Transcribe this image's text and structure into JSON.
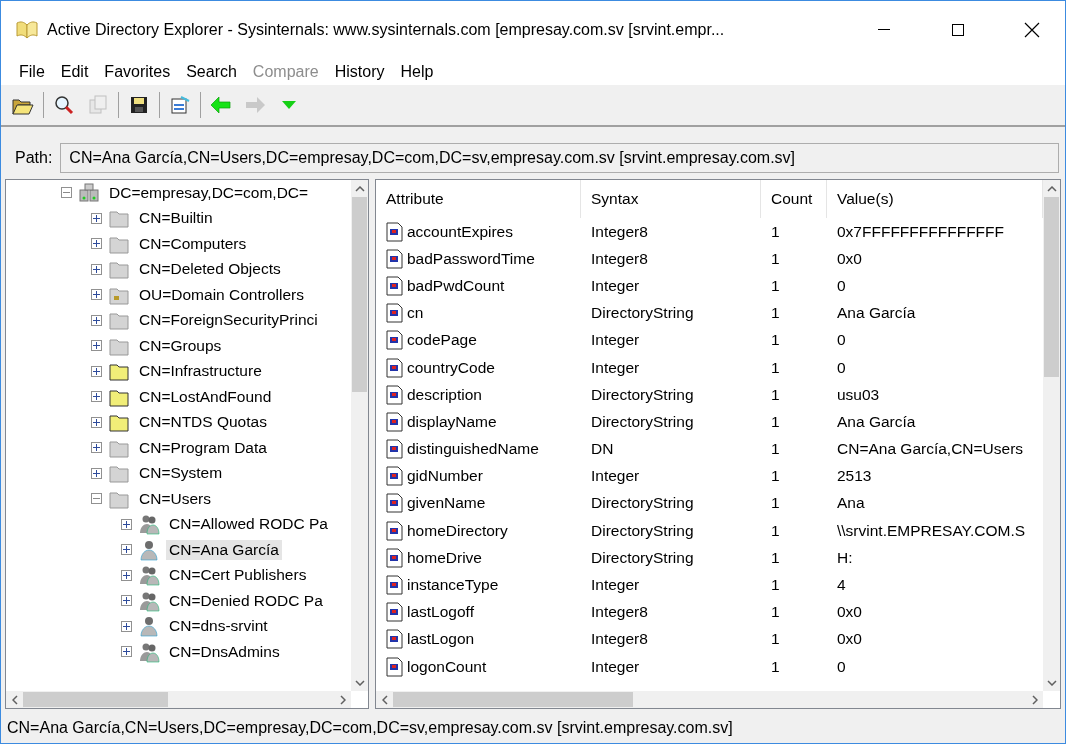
{
  "window": {
    "title": "Active Directory Explorer - Sysinternals: www.sysinternals.com [empresay.com.sv [srvint.empr..."
  },
  "menu": [
    {
      "label": "File",
      "disabled": false
    },
    {
      "label": "Edit",
      "disabled": false
    },
    {
      "label": "Favorites",
      "disabled": false
    },
    {
      "label": "Search",
      "disabled": false
    },
    {
      "label": "Compare",
      "disabled": true
    },
    {
      "label": "History",
      "disabled": false
    },
    {
      "label": "Help",
      "disabled": false
    }
  ],
  "toolbar": [
    {
      "kind": "open",
      "disabled": false
    },
    {
      "kind": "sep"
    },
    {
      "kind": "search",
      "disabled": false
    },
    {
      "kind": "copy",
      "disabled": true
    },
    {
      "kind": "sep"
    },
    {
      "kind": "save",
      "disabled": false
    },
    {
      "kind": "sep"
    },
    {
      "kind": "properties",
      "disabled": false
    },
    {
      "kind": "sep"
    },
    {
      "kind": "back",
      "disabled": false
    },
    {
      "kind": "forward",
      "disabled": true
    },
    {
      "kind": "dropdown",
      "disabled": false
    }
  ],
  "path": {
    "label": "Path:",
    "value": "CN=Ana García,CN=Users,DC=empresay,DC=com,DC=sv,empresay.com.sv [srvint.empresay.com.sv]"
  },
  "tree": [
    {
      "label": "DC=empresay,DC=com,DC=",
      "kind": "domain",
      "expanded": true,
      "selected": false,
      "children": [
        {
          "label": "CN=Builtin",
          "kind": "folder",
          "expanded": false,
          "selected": false
        },
        {
          "label": "CN=Computers",
          "kind": "folder",
          "expanded": false,
          "selected": false
        },
        {
          "label": "CN=Deleted Objects",
          "kind": "folder",
          "expanded": false,
          "selected": false
        },
        {
          "label": "OU=Domain Controllers",
          "kind": "ou",
          "expanded": false,
          "selected": false
        },
        {
          "label": "CN=ForeignSecurityPrinci",
          "kind": "folder",
          "expanded": false,
          "selected": false
        },
        {
          "label": "CN=Groups",
          "kind": "folder",
          "expanded": false,
          "selected": false
        },
        {
          "label": "CN=Infrastructure",
          "kind": "yellow-folder",
          "expanded": false,
          "selected": false
        },
        {
          "label": "CN=LostAndFound",
          "kind": "yellow-folder",
          "expanded": false,
          "selected": false
        },
        {
          "label": "CN=NTDS Quotas",
          "kind": "yellow-folder",
          "expanded": false,
          "selected": false
        },
        {
          "label": "CN=Program Data",
          "kind": "folder",
          "expanded": false,
          "selected": false
        },
        {
          "label": "CN=System",
          "kind": "folder",
          "expanded": false,
          "selected": false
        },
        {
          "label": "CN=Users",
          "kind": "folder",
          "expanded": true,
          "selected": false,
          "children": [
            {
              "label": "CN=Allowed RODC Pa",
              "kind": "group",
              "expanded": false,
              "selected": false
            },
            {
              "label": "CN=Ana García",
              "kind": "user",
              "expanded": false,
              "selected": true
            },
            {
              "label": "CN=Cert Publishers",
              "kind": "group",
              "expanded": false,
              "selected": false
            },
            {
              "label": "CN=Denied RODC Pa",
              "kind": "group",
              "expanded": false,
              "selected": false
            },
            {
              "label": "CN=dns-srvint",
              "kind": "user",
              "expanded": false,
              "selected": false
            },
            {
              "label": "CN=DnsAdmins",
              "kind": "group",
              "expanded": false,
              "selected": false
            }
          ]
        }
      ]
    }
  ],
  "table": {
    "columns": [
      "Attribute",
      "Syntax",
      "Count",
      "Value(s)"
    ],
    "rows": [
      [
        "accountExpires",
        "Integer8",
        "1",
        "0x7FFFFFFFFFFFFFFF"
      ],
      [
        "badPasswordTime",
        "Integer8",
        "1",
        "0x0"
      ],
      [
        "badPwdCount",
        "Integer",
        "1",
        "0"
      ],
      [
        "cn",
        "DirectoryString",
        "1",
        "Ana García"
      ],
      [
        "codePage",
        "Integer",
        "1",
        "0"
      ],
      [
        "countryCode",
        "Integer",
        "1",
        "0"
      ],
      [
        "description",
        "DirectoryString",
        "1",
        "usu03"
      ],
      [
        "displayName",
        "DirectoryString",
        "1",
        "Ana García"
      ],
      [
        "distinguishedName",
        "DN",
        "1",
        "CN=Ana García,CN=Users"
      ],
      [
        "gidNumber",
        "Integer",
        "1",
        "2513"
      ],
      [
        "givenName",
        "DirectoryString",
        "1",
        "Ana"
      ],
      [
        "homeDirectory",
        "DirectoryString",
        "1",
        "\\\\srvint.EMPRESAY.COM.S"
      ],
      [
        "homeDrive",
        "DirectoryString",
        "1",
        "H:"
      ],
      [
        "instanceType",
        "Integer",
        "1",
        "4"
      ],
      [
        "lastLogoff",
        "Integer8",
        "1",
        "0x0"
      ],
      [
        "lastLogon",
        "Integer8",
        "1",
        "0x0"
      ],
      [
        "logonCount",
        "Integer",
        "1",
        "0"
      ]
    ]
  },
  "status_bar": "CN=Ana García,CN=Users,DC=empresay,DC=com,DC=sv,empresay.com.sv [srvint.empresay.com.sv]"
}
